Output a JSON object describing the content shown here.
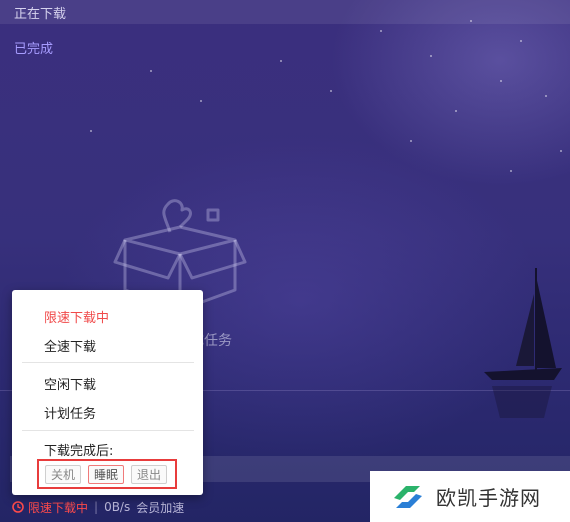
{
  "top": {
    "downloading_tab": "正在下载",
    "completed_tab": "已完成"
  },
  "empty_state": {
    "text": "成任务"
  },
  "popup": {
    "items": [
      "限速下载中",
      "全速下载",
      "空闲下载",
      "计划任务"
    ],
    "after_download_label": "下载完成后:",
    "options": [
      "关机",
      "睡眠",
      "退出"
    ],
    "selected_option": "睡眠"
  },
  "status_bar": {
    "limit_text": "限速下载中",
    "separator": "|",
    "speed": "0B/s",
    "vip_text": "会员加速"
  },
  "watermark": {
    "text": "欧凯手游网"
  },
  "colors": {
    "accent_red": "#f04a4a",
    "completed_purple": "#a79cff",
    "background_top": "#3b2f7e"
  }
}
